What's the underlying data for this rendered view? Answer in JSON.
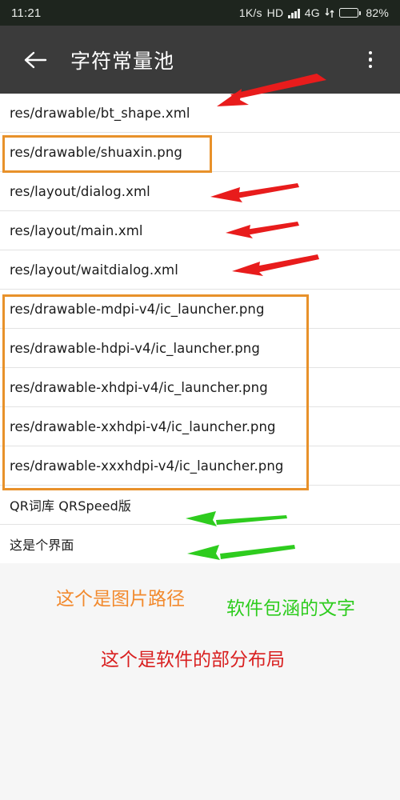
{
  "status_bar": {
    "time": "11:21",
    "net_speed": "1K/s",
    "hd": "HD",
    "network": "4G",
    "battery_percent": "82%",
    "battery_level": 82,
    "icons": [
      "signal-bars-icon",
      "data-transfer-icon",
      "battery-icon"
    ],
    "background_color": "#1e251e"
  },
  "app_bar": {
    "back_icon": "back-arrow-icon",
    "title": "字符常量池",
    "overflow_icon": "overflow-menu-icon",
    "background_color": "#3b3b3b"
  },
  "list": {
    "items": [
      {
        "label": "res/drawable/bt_shape.xml",
        "type": "path"
      },
      {
        "label": "res/drawable/shuaxin.png",
        "type": "path"
      },
      {
        "label": "res/layout/dialog.xml",
        "type": "path"
      },
      {
        "label": "res/layout/main.xml",
        "type": "path"
      },
      {
        "label": "res/layout/waitdialog.xml",
        "type": "path"
      },
      {
        "label": "res/drawable-mdpi-v4/ic_launcher.png",
        "type": "path"
      },
      {
        "label": "res/drawable-hdpi-v4/ic_launcher.png",
        "type": "path"
      },
      {
        "label": "res/drawable-xhdpi-v4/ic_launcher.png",
        "type": "path"
      },
      {
        "label": "res/drawable-xxhdpi-v4/ic_launcher.png",
        "type": "path"
      },
      {
        "label": "res/drawable-xxxhdpi-v4/ic_launcher.png",
        "type": "path"
      },
      {
        "label": "QR词库 QRSpeed版",
        "type": "text"
      },
      {
        "label": "这是个界面",
        "type": "text"
      }
    ]
  },
  "annotations": {
    "highlight_color": "#e8912a",
    "red_arrow_color": "#e81c1c",
    "green_arrow_color": "#2ecc1e",
    "captions": [
      {
        "text": "这个是图片路径",
        "color": "#f28a2e"
      },
      {
        "text": "软件包涵的文字",
        "color": "#2ecc1e"
      },
      {
        "text": "这个是软件的部分布局",
        "color": "#d92020"
      }
    ]
  }
}
